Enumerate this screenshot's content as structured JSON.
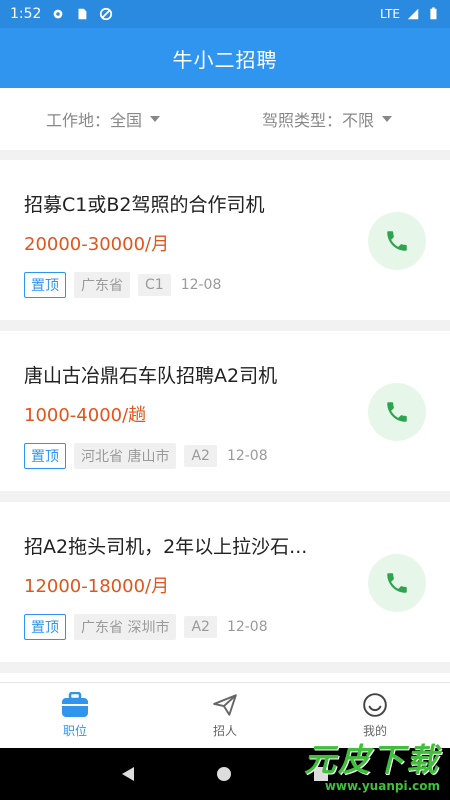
{
  "status_bar": {
    "time": "1:52",
    "network": "LTE"
  },
  "app_bar": {
    "title": "牛小二招聘"
  },
  "filters": [
    {
      "label": "工作地",
      "value": "全国",
      "separator": "："
    },
    {
      "label": "驾照类型",
      "value": "不限",
      "separator": "："
    }
  ],
  "jobs": [
    {
      "title": "招募C1或B2驾照的合作司机",
      "salary": "20000-30000/月",
      "badge": "置顶",
      "location": "广东省",
      "license": "C1",
      "date": "12-08"
    },
    {
      "title": "唐山古冶鼎石车队招聘A2司机",
      "salary": "1000-4000/趟",
      "badge": "置顶",
      "location": "河北省 唐山市",
      "license": "A2",
      "date": "12-08"
    },
    {
      "title": "招A2拖头司机，2年以上拉沙石...",
      "salary": "12000-18000/月",
      "badge": "置顶",
      "location": "广东省 深圳市",
      "license": "A2",
      "date": "12-08"
    }
  ],
  "tabs": [
    {
      "label": "职位",
      "icon": "briefcase-icon",
      "active": true
    },
    {
      "label": "招人",
      "icon": "send-icon",
      "active": false
    },
    {
      "label": "我的",
      "icon": "smile-icon",
      "active": false
    }
  ],
  "watermark": {
    "text": "元皮下载",
    "url": "www.yuanpi.com"
  },
  "colors": {
    "primary": "#2f95ef",
    "salary": "#e2551b",
    "call_bg": "#e6f7ea",
    "call_icon": "#2ea44f"
  }
}
